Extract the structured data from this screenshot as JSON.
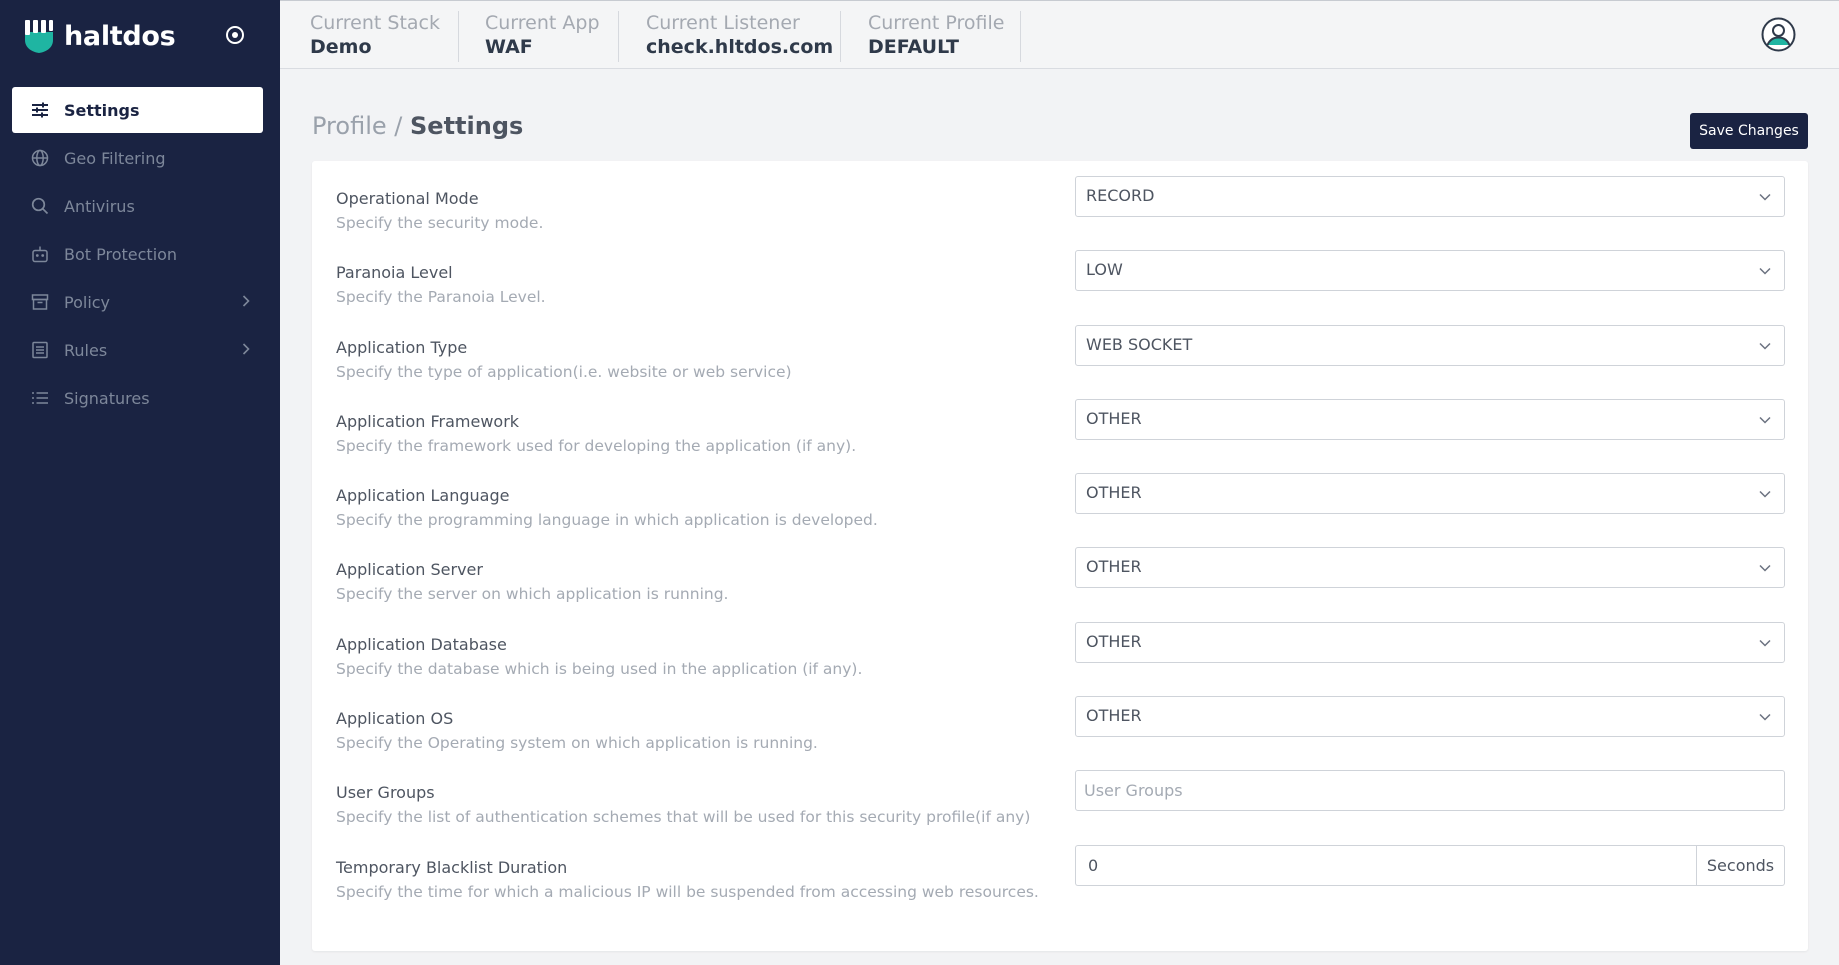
{
  "brand": {
    "name": "haltdos",
    "logo_icon": "haltdos-logo-icon",
    "accent": "#1fb5a2"
  },
  "sidebar": {
    "toggle_icon": "target-icon",
    "items": [
      {
        "label": "Settings",
        "icon": "sliders-icon",
        "active": true
      },
      {
        "label": "Geo Filtering",
        "icon": "globe-icon"
      },
      {
        "label": "Antivirus",
        "icon": "search-icon"
      },
      {
        "label": "Bot Protection",
        "icon": "robot-icon"
      },
      {
        "label": "Policy",
        "icon": "archive-icon",
        "has_children": true
      },
      {
        "label": "Rules",
        "icon": "list-box-icon",
        "has_children": true
      },
      {
        "label": "Signatures",
        "icon": "list-icon"
      }
    ]
  },
  "topbar": {
    "context": [
      {
        "label": "Current Stack",
        "value": "Demo"
      },
      {
        "label": "Current App",
        "value": "WAF"
      },
      {
        "label": "Current Listener",
        "value": "check.hltdos.com"
      },
      {
        "label": "Current Profile",
        "value": "DEFAULT"
      }
    ],
    "avatar_icon": "user-avatar-icon"
  },
  "page": {
    "breadcrumb_parent": "Profile",
    "breadcrumb_separator": "/",
    "breadcrumb_current": "Settings",
    "save_label": "Save Changes"
  },
  "form": {
    "fields": [
      {
        "label": "Operational Mode",
        "help": "Specify the security mode.",
        "type": "select",
        "value": "RECORD"
      },
      {
        "label": "Paranoia Level",
        "help": "Specify the Paranoia Level.",
        "type": "select",
        "value": "LOW"
      },
      {
        "label": "Application Type",
        "help": "Specify the type of application(i.e. website or web service)",
        "type": "select",
        "value": "WEB SOCKET"
      },
      {
        "label": "Application Framework",
        "help": "Specify the framework used for developing the application (if any).",
        "type": "select",
        "value": "OTHER"
      },
      {
        "label": "Application Language",
        "help": "Specify the programming language in which application is developed.",
        "type": "select",
        "value": "OTHER"
      },
      {
        "label": "Application Server",
        "help": "Specify the server on which application is running.",
        "type": "select",
        "value": "OTHER"
      },
      {
        "label": "Application Database",
        "help": "Specify the database which is being used in the application (if any).",
        "type": "select",
        "value": "OTHER"
      },
      {
        "label": "Application OS",
        "help": "Specify the Operating system on which application is running.",
        "type": "select",
        "value": "OTHER"
      },
      {
        "label": "User Groups",
        "help": "Specify the list of authentication schemes that will be used for this security profile(if any)",
        "type": "text",
        "value": "",
        "placeholder": "User Groups"
      },
      {
        "label": "Temporary Blacklist Duration",
        "help": "Specify the time for which a malicious IP will be suspended from accessing web resources.",
        "type": "number",
        "value": "0",
        "unit": "Seconds"
      }
    ]
  },
  "colors": {
    "sidebar_bg": "#1a2342",
    "primary_button": "#1a2342",
    "page_bg": "#f2f3f5"
  }
}
